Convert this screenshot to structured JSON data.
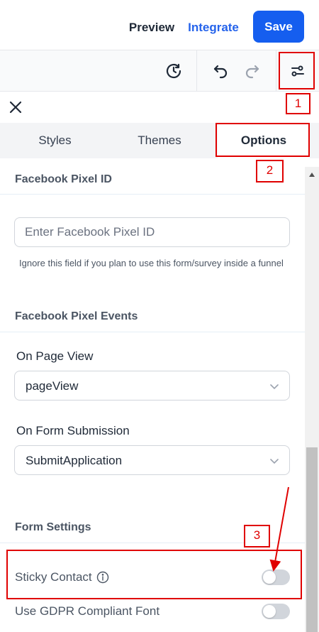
{
  "header": {
    "preview_label": "Preview",
    "integrate_label": "Integrate",
    "save_label": "Save"
  },
  "toolbar": {
    "icons": [
      "history-icon",
      "undo-icon",
      "redo-icon",
      "settings-sliders-icon"
    ]
  },
  "tabs": [
    {
      "label": "Styles",
      "active": false
    },
    {
      "label": "Themes",
      "active": false
    },
    {
      "label": "Options",
      "active": true
    }
  ],
  "options": {
    "pixel_id_section": {
      "title": "Facebook Pixel ID",
      "input_placeholder": "Enter Facebook Pixel ID",
      "input_value": "",
      "help_text": "Ignore this field if you plan to use this form/survey inside a funnel"
    },
    "pixel_events_section": {
      "title": "Facebook Pixel Events",
      "page_view_label": "On Page View",
      "page_view_value": "pageView",
      "submission_label": "On Form Submission",
      "submission_value": "SubmitApplication"
    },
    "form_settings_section": {
      "title": "Form Settings",
      "sticky_contact_label": "Sticky Contact",
      "sticky_contact_enabled": false,
      "gdpr_font_label": "Use GDPR Compliant Font",
      "gdpr_font_enabled": false
    }
  },
  "annotations": {
    "marker_1": "1",
    "marker_2": "2",
    "marker_3": "3",
    "color": "#e00000"
  },
  "colors": {
    "primary": "#155eef",
    "link": "#2563eb"
  }
}
